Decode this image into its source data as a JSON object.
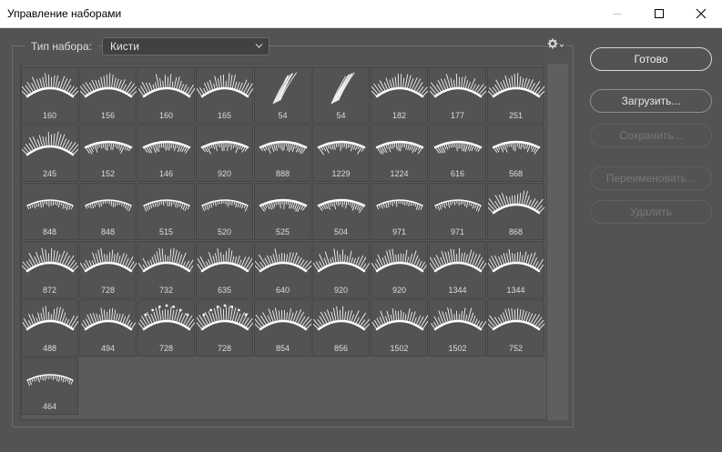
{
  "window": {
    "title": "Управление наборами"
  },
  "preset_type": {
    "label": "Тип набора:",
    "selected": "Кисти"
  },
  "brushes": [
    {
      "size": "160",
      "shape": "fan"
    },
    {
      "size": "156",
      "shape": "fan"
    },
    {
      "size": "160",
      "shape": "spiky"
    },
    {
      "size": "165",
      "shape": "spiky"
    },
    {
      "size": "54",
      "shape": "single"
    },
    {
      "size": "54",
      "shape": "single"
    },
    {
      "size": "182",
      "shape": "fan"
    },
    {
      "size": "177",
      "shape": "fan"
    },
    {
      "size": "251",
      "shape": "fan"
    },
    {
      "size": "245",
      "shape": "fan"
    },
    {
      "size": "152",
      "shape": "bottom"
    },
    {
      "size": "146",
      "shape": "bottom"
    },
    {
      "size": "920",
      "shape": "bottom"
    },
    {
      "size": "888",
      "shape": "bottom"
    },
    {
      "size": "1229",
      "shape": "bottom"
    },
    {
      "size": "1224",
      "shape": "bottom"
    },
    {
      "size": "616",
      "shape": "bottom"
    },
    {
      "size": "568",
      "shape": "bottom"
    },
    {
      "size": "848",
      "shape": "thin"
    },
    {
      "size": "848",
      "shape": "thin"
    },
    {
      "size": "515",
      "shape": "thin"
    },
    {
      "size": "520",
      "shape": "thin"
    },
    {
      "size": "525",
      "shape": "bottom"
    },
    {
      "size": "504",
      "shape": "bottom"
    },
    {
      "size": "971",
      "shape": "thin"
    },
    {
      "size": "971",
      "shape": "thin"
    },
    {
      "size": "868",
      "shape": "fan"
    },
    {
      "size": "872",
      "shape": "fan"
    },
    {
      "size": "728",
      "shape": "spiky"
    },
    {
      "size": "732",
      "shape": "spiky"
    },
    {
      "size": "635",
      "shape": "spiky"
    },
    {
      "size": "640",
      "shape": "fan"
    },
    {
      "size": "920",
      "shape": "spiky"
    },
    {
      "size": "920",
      "shape": "spiky"
    },
    {
      "size": "1344",
      "shape": "spiky"
    },
    {
      "size": "1344",
      "shape": "spiky"
    },
    {
      "size": "488",
      "shape": "spiky"
    },
    {
      "size": "494",
      "shape": "spiky"
    },
    {
      "size": "728",
      "shape": "dots"
    },
    {
      "size": "728",
      "shape": "dots"
    },
    {
      "size": "854",
      "shape": "fan"
    },
    {
      "size": "856",
      "shape": "fan"
    },
    {
      "size": "1502",
      "shape": "spiky"
    },
    {
      "size": "1502",
      "shape": "spiky"
    },
    {
      "size": "752",
      "shape": "fan"
    },
    {
      "size": "464",
      "shape": "thin"
    }
  ],
  "buttons": {
    "done": "Готово",
    "load": "Загрузить...",
    "save": "Сохранить...",
    "rename": "Переименовать...",
    "delete": "Удалить"
  }
}
